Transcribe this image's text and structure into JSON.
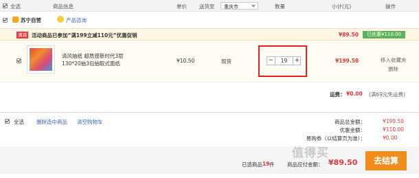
{
  "header": {
    "select_all": "全选",
    "product_info": "商品信息",
    "unit_price": "单价",
    "delivery_to": "送货至",
    "city": "重庆市",
    "quantity": "数量",
    "subtotal": "小计(元)",
    "action": "操作"
  },
  "store": {
    "name": "苏宁自营",
    "service": "产品咨询"
  },
  "promo": {
    "badge": "满减",
    "text": "活动商品已参加“满199立减110元”优惠促销",
    "amount": "¥89.50",
    "saved": "已优惠¥110.00"
  },
  "item": {
    "title": "清风抽纸 超质感新时代3层 130*20抽3包抽取式面纸",
    "price": "¥10.50",
    "stock": "现货",
    "qty": "19",
    "minus": "−",
    "plus": "+",
    "subtotal": "¥199.50",
    "fav": "移入收藏夹",
    "delete": "删除"
  },
  "shipping": {
    "label": "运费：",
    "value": "¥0.00",
    "note": "(满69元免运费)"
  },
  "footer": {
    "select_all": "全选",
    "delete_selected": "删除选中商品",
    "clear_cart": "清空购物车",
    "total_label": "商品总金额：",
    "total_value": "¥199.50",
    "discount_label": "优惠金额：",
    "discount_value": "¥110.00",
    "extra_label": "易购券（以结算页为准）：",
    "extra_value": "¥0.00",
    "count_prefix": "已选商品",
    "count": "19",
    "count_suffix": "件",
    "payable_label": "商品应付金额：",
    "payable_value": "¥89.50",
    "checkout": "去结算"
  },
  "watermark": "值得买",
  "colors": {
    "accent_red": "#e4393c",
    "checkout_orange": "#f08d1b",
    "saved_green": "#5db15b",
    "highlight_box": "#e62020"
  }
}
